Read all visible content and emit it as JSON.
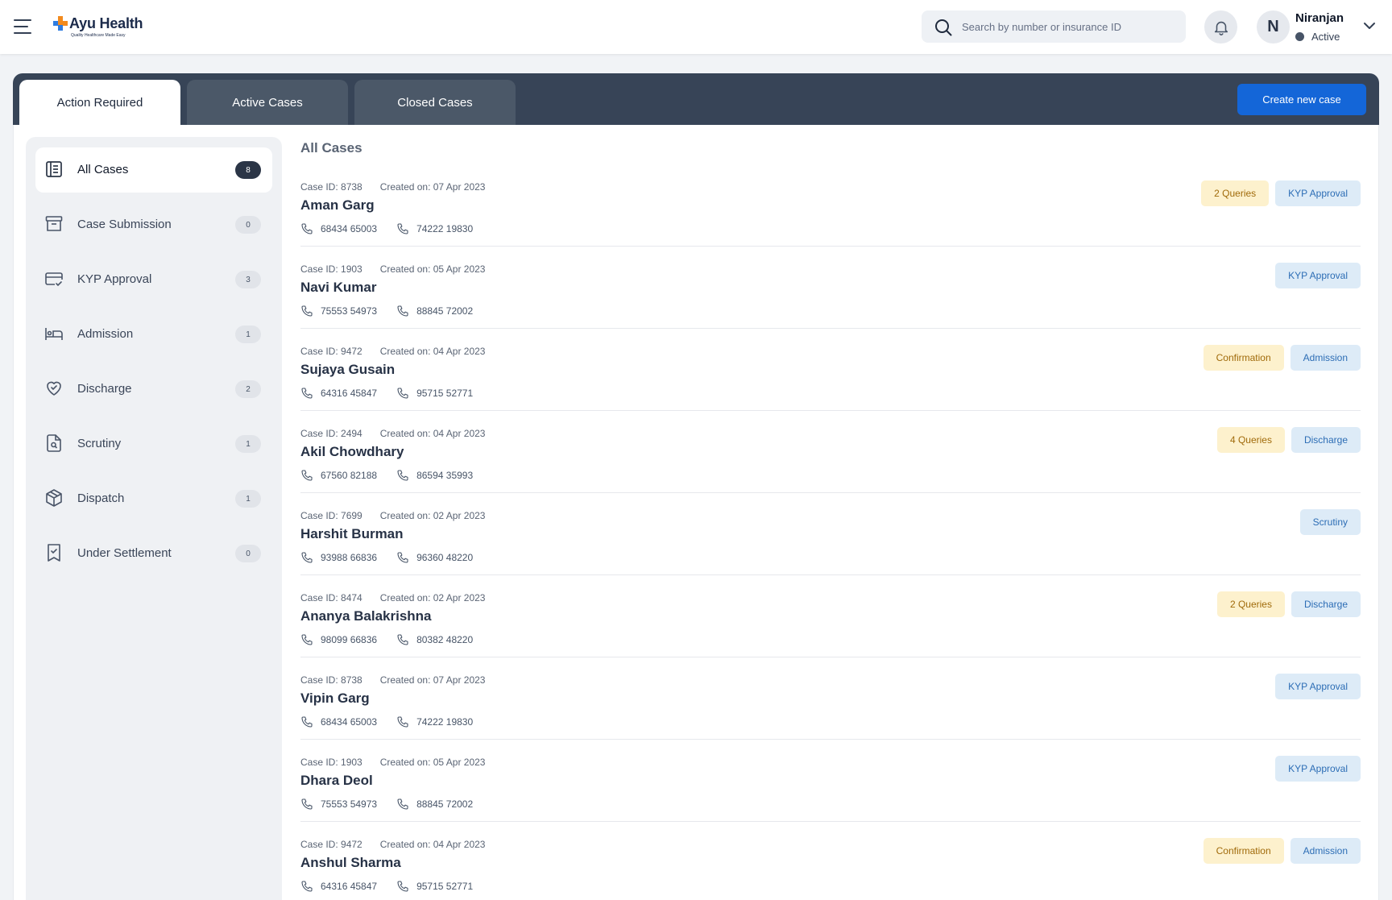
{
  "app": {
    "logo_title": "Ayu Health",
    "logo_tagline": "Quality Healthcare Made Easy"
  },
  "search": {
    "placeholder": "Search by number or insurance ID",
    "value": ""
  },
  "user": {
    "initial": "N",
    "name": "Niranjan",
    "status": "Active"
  },
  "tabs": [
    {
      "label": "Action Required",
      "active": true
    },
    {
      "label": "Active Cases",
      "active": false
    },
    {
      "label": "Closed Cases",
      "active": false
    }
  ],
  "create_button": "Create new case",
  "sidebar": {
    "items": [
      {
        "label": "All Cases",
        "count": "8",
        "icon": "cases-icon",
        "active": true
      },
      {
        "label": "Case Submission",
        "count": "0",
        "icon": "archive-icon",
        "active": false
      },
      {
        "label": "KYP Approval",
        "count": "3",
        "icon": "card-check-icon",
        "active": false
      },
      {
        "label": "Admission",
        "count": "1",
        "icon": "bed-icon",
        "active": false
      },
      {
        "label": "Discharge",
        "count": "2",
        "icon": "heart-check-icon",
        "active": false
      },
      {
        "label": "Scrutiny",
        "count": "1",
        "icon": "file-search-icon",
        "active": false
      },
      {
        "label": "Dispatch",
        "count": "1",
        "icon": "package-icon",
        "active": false
      },
      {
        "label": "Under Settlement",
        "count": "0",
        "icon": "receipt-check-icon",
        "active": false
      }
    ]
  },
  "main": {
    "title": "All Cases",
    "cases": [
      {
        "case_id": "Case ID: 8738",
        "created": "Created on: 07 Apr 2023",
        "name": "Aman Garg",
        "phones": [
          "68434 65003",
          "74222 19830"
        ],
        "tags": [
          {
            "label": "2 Queries",
            "kind": "warn"
          },
          {
            "label": "KYP Approval",
            "kind": "info"
          }
        ]
      },
      {
        "case_id": "Case ID: 1903",
        "created": "Created on: 05 Apr 2023",
        "name": "Navi Kumar",
        "phones": [
          "75553 54973",
          "88845 72002"
        ],
        "tags": [
          {
            "label": "KYP Approval",
            "kind": "info"
          }
        ]
      },
      {
        "case_id": "Case ID: 9472",
        "created": "Created on: 04 Apr 2023",
        "name": "Sujaya Gusain",
        "phones": [
          "64316 45847",
          "95715 52771"
        ],
        "tags": [
          {
            "label": "Confirmation",
            "kind": "warn"
          },
          {
            "label": "Admission",
            "kind": "info"
          }
        ]
      },
      {
        "case_id": "Case ID: 2494",
        "created": "Created on: 04 Apr 2023",
        "name": "Akil Chowdhary",
        "phones": [
          "67560 82188",
          "86594 35993"
        ],
        "tags": [
          {
            "label": "4 Queries",
            "kind": "warn"
          },
          {
            "label": "Discharge",
            "kind": "info"
          }
        ]
      },
      {
        "case_id": "Case ID: 7699",
        "created": "Created on: 02 Apr 2023",
        "name": "Harshit Burman",
        "phones": [
          "93988 66836",
          "96360 48220"
        ],
        "tags": [
          {
            "label": "Scrutiny",
            "kind": "info"
          }
        ]
      },
      {
        "case_id": "Case ID: 8474",
        "created": "Created on: 02 Apr 2023",
        "name": "Ananya Balakrishna",
        "phones": [
          "98099 66836",
          "80382 48220"
        ],
        "tags": [
          {
            "label": "2 Queries",
            "kind": "warn"
          },
          {
            "label": "Discharge",
            "kind": "info"
          }
        ]
      },
      {
        "case_id": "Case ID: 8738",
        "created": "Created on: 07 Apr 2023",
        "name": "Vipin Garg",
        "phones": [
          "68434 65003",
          "74222 19830"
        ],
        "tags": [
          {
            "label": "KYP Approval",
            "kind": "info"
          }
        ]
      },
      {
        "case_id": "Case ID: 1903",
        "created": "Created on: 05 Apr 2023",
        "name": "Dhara Deol",
        "phones": [
          "75553 54973",
          "88845 72002"
        ],
        "tags": [
          {
            "label": "KYP Approval",
            "kind": "info"
          }
        ]
      },
      {
        "case_id": "Case ID: 9472",
        "created": "Created on: 04 Apr 2023",
        "name": "Anshul Sharma",
        "phones": [
          "64316 45847",
          "95715 52771"
        ],
        "tags": [
          {
            "label": "Confirmation",
            "kind": "warn"
          },
          {
            "label": "Admission",
            "kind": "info"
          }
        ]
      }
    ]
  },
  "colors": {
    "band": "#374457",
    "primary": "#1466d8",
    "warn_bg": "#fdf1cd",
    "info_bg": "#ddebf7"
  }
}
